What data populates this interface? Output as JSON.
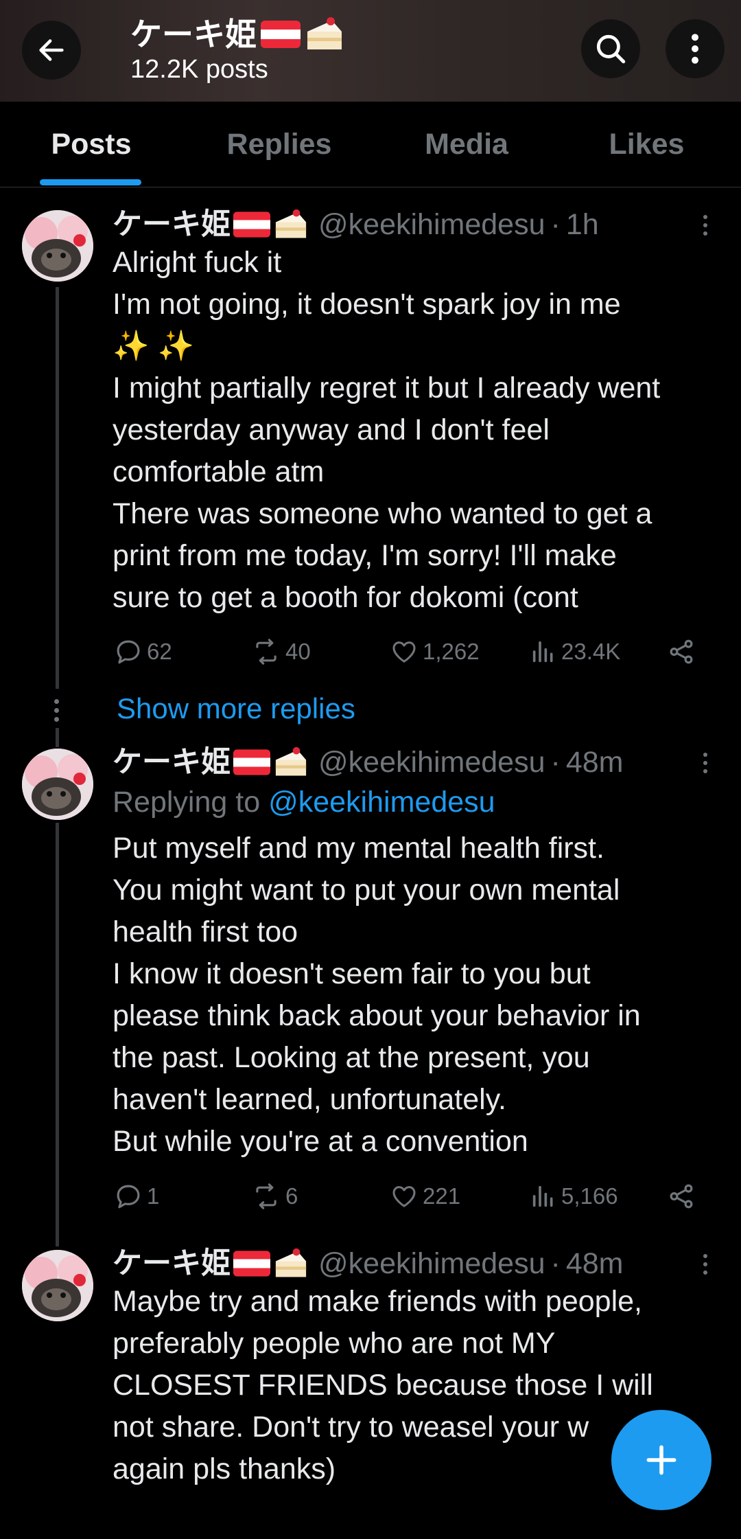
{
  "header": {
    "title": "ケーキ姫",
    "posts_count": "12.2K posts",
    "back_icon": "arrow-left-icon",
    "search_icon": "search-icon",
    "more_icon": "more-vertical-icon"
  },
  "tabs": [
    {
      "label": "Posts",
      "active": true
    },
    {
      "label": "Replies",
      "active": false
    },
    {
      "label": "Media",
      "active": false
    },
    {
      "label": "Likes",
      "active": false
    }
  ],
  "posts": [
    {
      "name": "ケーキ姫",
      "handle": "@keekihimedesu",
      "time": "1h",
      "text": "Alright fuck it\nI'm not going, it doesn't spark joy in me\n✨ ✨\nI might partially regret it but I already went\nyesterday anyway and I don't feel\ncomfortable atm\nThere was someone who wanted to get a\nprint from me today, I'm sorry! I'll make\nsure to get a booth for dokomi (cont",
      "replies": "62",
      "reposts": "40",
      "likes": "1,262",
      "views": "23.4K"
    },
    {
      "name": "ケーキ姫",
      "handle": "@keekihimedesu",
      "time": "48m",
      "replying_label": "Replying to ",
      "replying_to": "@keekihimedesu",
      "text": "Put myself and my mental health first.\nYou might want to put your own mental\nhealth first too\nI know it doesn't seem fair to you but\nplease think back about your behavior in\nthe past. Looking at the present, you\nhaven't learned, unfortunately.\nBut while you're at a convention",
      "replies": "1",
      "reposts": "6",
      "likes": "221",
      "views": "5,166"
    },
    {
      "name": "ケーキ姫",
      "handle": "@keekihimedesu",
      "time": "48m",
      "text": "Maybe try and make friends with people,\npreferably people who are not MY\nCLOSEST FRIENDS because those I will\nnot share. Don't try to weasel your w\nagain pls thanks)"
    }
  ],
  "show_more": "Show more replies",
  "fab_icon": "plus-icon",
  "colors": {
    "accent": "#1d9bf0",
    "muted": "#71767b",
    "text": "#e7e9ea",
    "background": "#000000"
  }
}
